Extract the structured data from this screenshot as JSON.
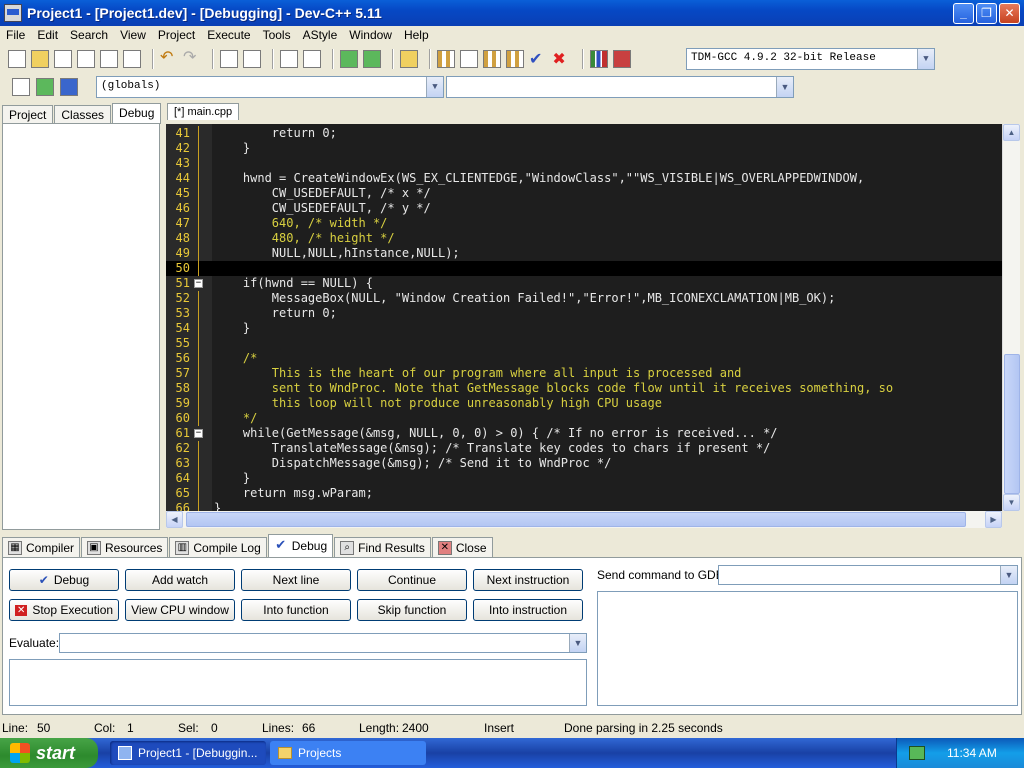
{
  "window": {
    "title": "Project1 - [Project1.dev] - [Debugging] - Dev-C++ 5.11"
  },
  "menu": [
    "File",
    "Edit",
    "Search",
    "View",
    "Project",
    "Execute",
    "Tools",
    "AStyle",
    "Window",
    "Help"
  ],
  "toolbar": {
    "compiler": "TDM-GCC 4.9.2 32-bit Release",
    "globals": "(globals)"
  },
  "left_tabs": [
    "Project",
    "Classes",
    "Debug"
  ],
  "editor": {
    "tab": "[*] main.cpp",
    "lines": [
      {
        "n": "41",
        "text": "        return 0;",
        "fold": "line"
      },
      {
        "n": "42",
        "text": "    }",
        "fold": "line"
      },
      {
        "n": "43",
        "text": "",
        "fold": "line"
      },
      {
        "n": "44",
        "text": "    hwnd = CreateWindowEx(WS_EX_CLIENTEDGE,\"WindowClass\",\"\"WS_VISIBLE|WS_OVERLAPPEDWINDOW,",
        "fold": "line"
      },
      {
        "n": "45",
        "text": "        CW_USEDEFAULT, /* x */",
        "fold": "line"
      },
      {
        "n": "46",
        "text": "        CW_USEDEFAULT, /* y */",
        "fold": "line"
      },
      {
        "n": "47",
        "text": "        640, /* width */",
        "fold": "line"
      },
      {
        "n": "48",
        "text": "        480, /* height */",
        "fold": "line"
      },
      {
        "n": "49",
        "text": "        NULL,NULL,hInstance,NULL);",
        "fold": "line"
      },
      {
        "n": "50",
        "text": "",
        "fold": "line"
      },
      {
        "n": "51",
        "text": "    if(hwnd == NULL) {",
        "fold": "box"
      },
      {
        "n": "52",
        "text": "        MessageBox(NULL, \"Window Creation Failed!\",\"Error!\",MB_ICONEXCLAMATION|MB_OK);",
        "fold": "line"
      },
      {
        "n": "53",
        "text": "        return 0;",
        "fold": "line"
      },
      {
        "n": "54",
        "text": "    }",
        "fold": "line"
      },
      {
        "n": "55",
        "text": "",
        "fold": "line"
      },
      {
        "n": "56",
        "text": "    /*",
        "fold": "line"
      },
      {
        "n": "57",
        "text": "        This is the heart of our program where all input is processed and",
        "fold": "line"
      },
      {
        "n": "58",
        "text": "        sent to WndProc. Note that GetMessage blocks code flow until it receives something, so",
        "fold": "line"
      },
      {
        "n": "59",
        "text": "        this loop will not produce unreasonably high CPU usage",
        "fold": "line"
      },
      {
        "n": "60",
        "text": "    */",
        "fold": "line"
      },
      {
        "n": "61",
        "text": "    while(GetMessage(&msg, NULL, 0, 0) > 0) { /* If no error is received... */",
        "fold": "box"
      },
      {
        "n": "62",
        "text": "        TranslateMessage(&msg); /* Translate key codes to chars if present */",
        "fold": "line"
      },
      {
        "n": "63",
        "text": "        DispatchMessage(&msg); /* Send it to WndProc */",
        "fold": "line"
      },
      {
        "n": "64",
        "text": "    }",
        "fold": "line"
      },
      {
        "n": "65",
        "text": "    return msg.wParam;",
        "fold": "line"
      },
      {
        "n": "66",
        "text": "}",
        "fold": "line"
      }
    ]
  },
  "bottom_tabs": [
    "Compiler",
    "Resources",
    "Compile Log",
    "Debug",
    "Find Results",
    "Close"
  ],
  "debug": {
    "buttons_row1": [
      "Debug",
      "Add watch",
      "Next line",
      "Continue",
      "Next instruction"
    ],
    "buttons_row2": [
      "Stop Execution",
      "View CPU window",
      "Into function",
      "Skip function",
      "Into instruction"
    ],
    "evaluate_label": "Evaluate:",
    "gdb_label": "Send command to GDB:"
  },
  "status": {
    "line_label": "Line:",
    "line": "50",
    "col_label": "Col:",
    "col": "1",
    "sel_label": "Sel:",
    "sel": "0",
    "lines_label": "Lines:",
    "lines": "66",
    "length_label": "Length:",
    "length": "2400",
    "mode": "Insert",
    "message": "Done parsing in 2.25 seconds"
  },
  "taskbar": {
    "start": "start",
    "tasks": [
      "Project1 - [Debuggin...",
      "Projects"
    ],
    "time": "11:34 AM"
  }
}
